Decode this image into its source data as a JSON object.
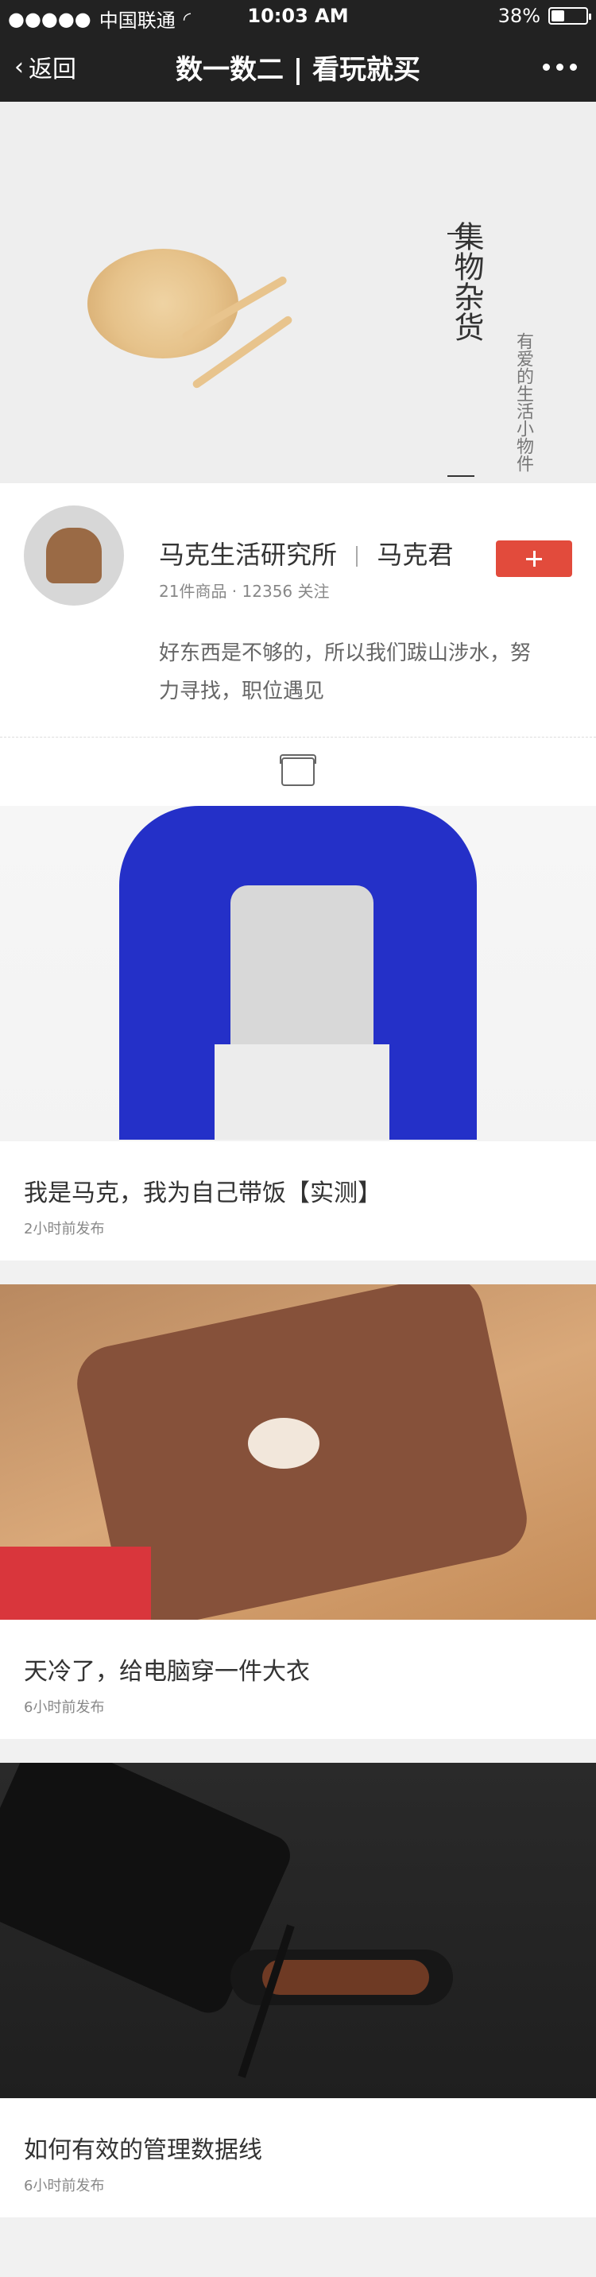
{
  "status_bar": {
    "signal_dots": "●●●●●",
    "carrier": "中国联通",
    "time": "10:03 AM",
    "battery_text": "38%",
    "battery_level": 0.38
  },
  "nav": {
    "back_label": "返回",
    "title": "数一数二 | 看玩就买",
    "more_icon": "ellipsis-icon"
  },
  "hero": {
    "title": "集物杂货",
    "subtitle": "有爱的生活小物件"
  },
  "profile": {
    "name": "马克生活研究所",
    "person": "马克君",
    "stats": "21件商品 · 12356 关注",
    "follow_button": "+",
    "bio": "好东西是不够的，所以我们跋山涉水，努力寻找，职位遇见"
  },
  "shop_icon": "shop-icon",
  "articles": [
    {
      "title": "我是马克，我为自己带饭【实测】",
      "time": "2小时前发布"
    },
    {
      "title": "天冷了，给电脑穿一件大衣",
      "time": "6小时前发布"
    },
    {
      "title": "如何有效的管理数据线",
      "time": "6小时前发布"
    }
  ]
}
